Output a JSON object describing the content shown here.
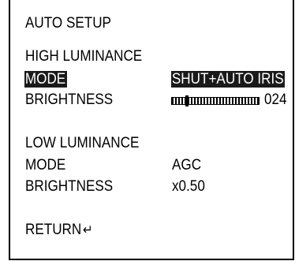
{
  "menu": {
    "title": "AUTO SETUP",
    "high_luminance": {
      "heading": "HIGH LUMINANCE",
      "mode_label": "MODE",
      "mode_value": "SHUT+AUTO IRIS",
      "brightness_label": "BRIGHTNESS",
      "brightness_value": "024",
      "brightness_level_fraction": 0.18
    },
    "low_luminance": {
      "heading": "LOW LUMINANCE",
      "mode_label": "MODE",
      "mode_value": "AGC",
      "brightness_label": "BRIGHTNESS",
      "brightness_value": "x0.50"
    },
    "return_label": "RETURN",
    "return_icon": "return-arrow-icon"
  },
  "colors": {
    "highlight_bg": "#1a1a1a",
    "highlight_text": "#ffffff",
    "text": "#000000",
    "background": "#ffffff"
  }
}
